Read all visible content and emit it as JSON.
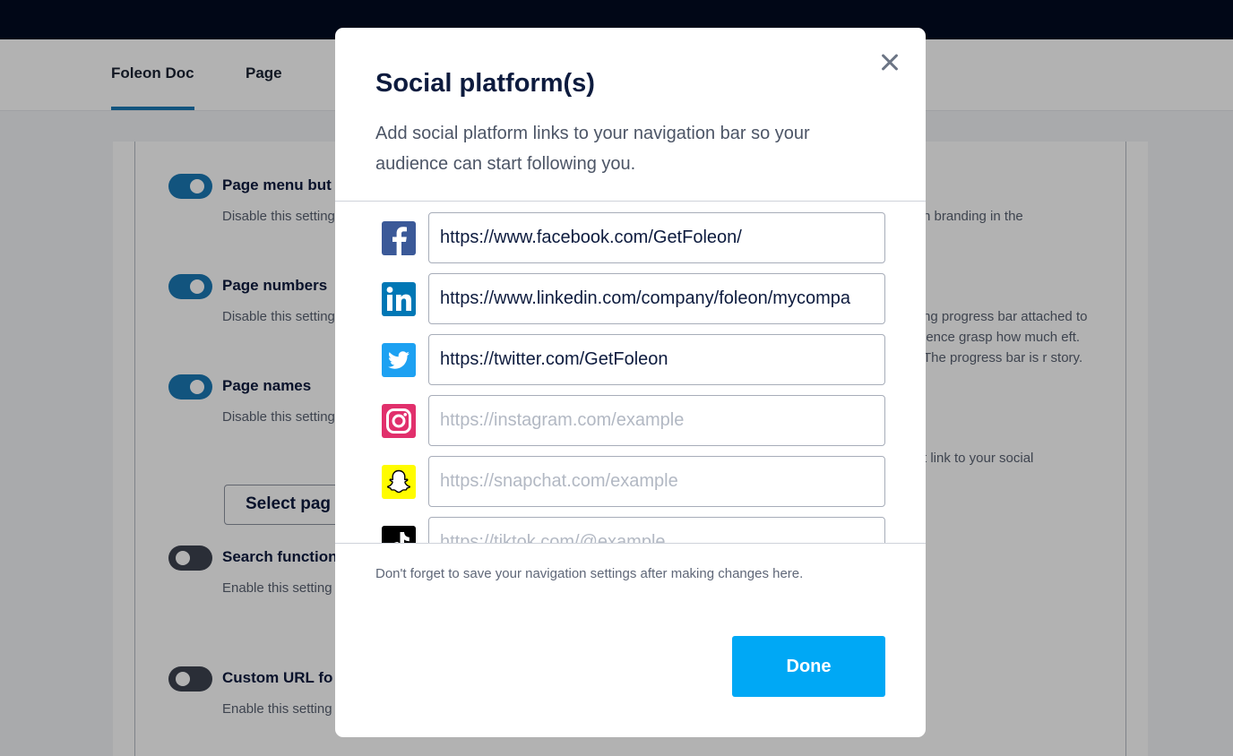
{
  "background": {
    "tabs": [
      {
        "label": "Foleon Doc",
        "active": true
      },
      {
        "label": "Page",
        "active": false
      }
    ],
    "settings": [
      {
        "title": "Page menu but",
        "enabled": true,
        "desc": "Disable this setting single-page Foleon"
      },
      {
        "title": "Page numbers",
        "enabled": true,
        "desc": "Disable this setting Useful for single-p"
      },
      {
        "title": "Page names",
        "enabled": true,
        "desc": "Disable this setting Click select pages out."
      },
      {
        "title": "Search function",
        "enabled": false,
        "desc": "Enable this setting navigation bar whi content in your Fo"
      },
      {
        "title": "Custom URL fo",
        "enabled": false,
        "desc": "Enable this setting navigation bar. If d Foleon Doc."
      }
    ],
    "select_pages_label": "Select pag",
    "right_texts": [
      "n branding in the",
      "ng progress bar attached to ience grasp how much eft. The progress bar is r story.",
      "t link to your social"
    ]
  },
  "modal": {
    "title": "Social platform(s)",
    "description": "Add social platform links to your navigation bar so your audience can start following you.",
    "platforms": [
      {
        "icon": "facebook-icon",
        "color": "#3b5998",
        "value": "https://www.facebook.com/GetFoleon/",
        "placeholder": ""
      },
      {
        "icon": "linkedin-icon",
        "color": "#0077b5",
        "value": "https://www.linkedin.com/company/foleon/mycompa",
        "placeholder": ""
      },
      {
        "icon": "twitter-icon",
        "color": "#1da1f2",
        "value": "https://twitter.com/GetFoleon",
        "placeholder": ""
      },
      {
        "icon": "instagram-icon",
        "color": "#e1306c",
        "value": "",
        "placeholder": "https://instagram.com/example"
      },
      {
        "icon": "snapchat-icon",
        "color": "#fffc00",
        "value": "",
        "placeholder": "https://snapchat.com/example"
      },
      {
        "icon": "tiktok-icon",
        "color": "#000000",
        "value": "",
        "placeholder": "https://tiktok.com/@example"
      }
    ],
    "footer_note": "Don't forget to save your navigation settings after making changes here.",
    "done_label": "Done",
    "accent_color": "#00a8f5"
  }
}
